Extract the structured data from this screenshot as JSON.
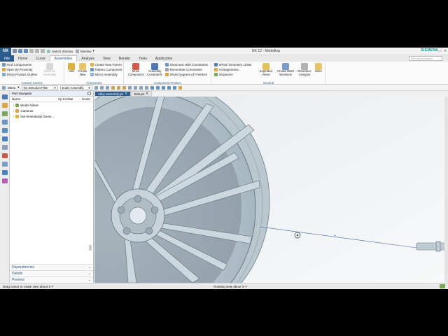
{
  "titlebar": {
    "logo": "NX",
    "switch_window": "Switch Window",
    "window_menu": "Window",
    "title": "NX 12 - Modelling",
    "brand": "SIEMENS"
  },
  "tabs": [
    "File",
    "Home",
    "Curve",
    "Assemblies",
    "Analysis",
    "View",
    "Render",
    "Tools",
    "Application"
  ],
  "active_tab": "Assemblies",
  "find_placeholder": "Find a Command",
  "ribbon": {
    "context_control": {
      "label": "Context Control",
      "items": [
        "Find Components",
        "Open by Proximity",
        "Show Product Outline"
      ],
      "big": "Work on Assembly"
    },
    "component": {
      "label": "Component",
      "add": "Add",
      "create_new": "Create New",
      "items": [
        "Create New Parent",
        "Pattern Component",
        "Mirror Assembly"
      ]
    },
    "component_position": {
      "label": "Component Position",
      "move": "Move Component",
      "constraints": "Assembly Constraints",
      "items": [
        "Show and Hide Constraints",
        "Remember Constraints",
        "Show Degrees of Freedom"
      ]
    },
    "general": {
      "label": "General",
      "items": [
        "WAVE Geometry Linker",
        "Arrangements",
        "Sequence"
      ],
      "exploded": "Exploded Views",
      "dmu": "Create DMU Worksets",
      "clearance": "Clearance Analysis",
      "more": "More"
    }
  },
  "toolbar": {
    "menu": "Menu",
    "filter": "No Selection Filter",
    "scope": "Entire Assembly"
  },
  "navigator": {
    "title": "Part Navigator",
    "columns": [
      "Name",
      "Up to Date",
      "Conte"
    ],
    "rows": [
      "Model Views",
      "Cameras",
      "Non-timestamp Geom..."
    ],
    "sections": [
      "Dependencies",
      "Details",
      "Preview"
    ]
  },
  "viewport_tabs": [
    "Alloy assembly.prt",
    "Bolt.prt"
  ],
  "status": {
    "left": "Drag cursor to rotate view about X-Y",
    "center": "Rotating view about X-Y"
  },
  "colors": {
    "accent": "#2b5b8a",
    "brand": "#009999",
    "model": "#c5d1d8",
    "background": "#f4f6f7"
  }
}
